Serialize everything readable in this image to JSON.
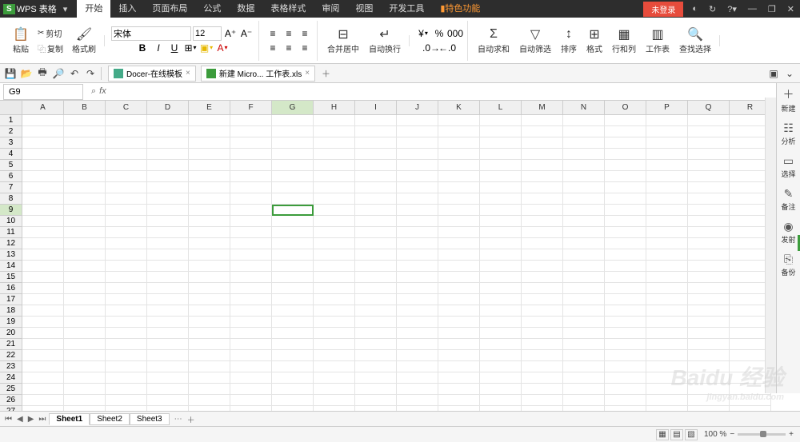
{
  "app": {
    "logo": "S",
    "name": "WPS 表格",
    "login": "未登录"
  },
  "menu": {
    "tabs": [
      "开始",
      "插入",
      "页面布局",
      "公式",
      "数据",
      "表格样式",
      "审阅",
      "视图",
      "开发工具"
    ],
    "special": "特色功能",
    "active": 0
  },
  "ribbon": {
    "paste": "粘贴",
    "cut": "剪切",
    "copy": "复制",
    "format_painter": "格式刷",
    "font_name": "宋体",
    "font_size": "12",
    "merge": "合并居中",
    "wrap": "自动换行",
    "autosum": "自动求和",
    "autofilter": "自动筛选",
    "sort": "排序",
    "format": "格式",
    "rowcol": "行和列",
    "worksheet": "工作表",
    "find": "查找选择"
  },
  "qat": {
    "tab1": "Docer-在线模板",
    "tab2": "新建 Micro... 工作表.xls"
  },
  "formula": {
    "cell_ref": "G9",
    "fx": "fx"
  },
  "grid": {
    "cols": [
      "A",
      "B",
      "C",
      "D",
      "E",
      "F",
      "G",
      "H",
      "I",
      "J",
      "K",
      "L",
      "M",
      "N",
      "O",
      "P",
      "Q",
      "R"
    ],
    "rows": 27,
    "active_col": 6,
    "active_row": 9
  },
  "sidebar": {
    "items": [
      {
        "icon": "＋",
        "label": "新建"
      },
      {
        "icon": "☷",
        "label": "分析"
      },
      {
        "icon": "▭",
        "label": "选择"
      },
      {
        "icon": "✎",
        "label": "备注"
      },
      {
        "icon": "◉",
        "label": "发射"
      },
      {
        "icon": "⎘",
        "label": "备份"
      }
    ]
  },
  "sheets": {
    "list": [
      "Sheet1",
      "Sheet2",
      "Sheet3"
    ],
    "active": 0
  },
  "status": {
    "zoom": "100 %"
  },
  "watermark": {
    "brand": "Baidu 经验",
    "url": "jingyan.baidu.com"
  }
}
